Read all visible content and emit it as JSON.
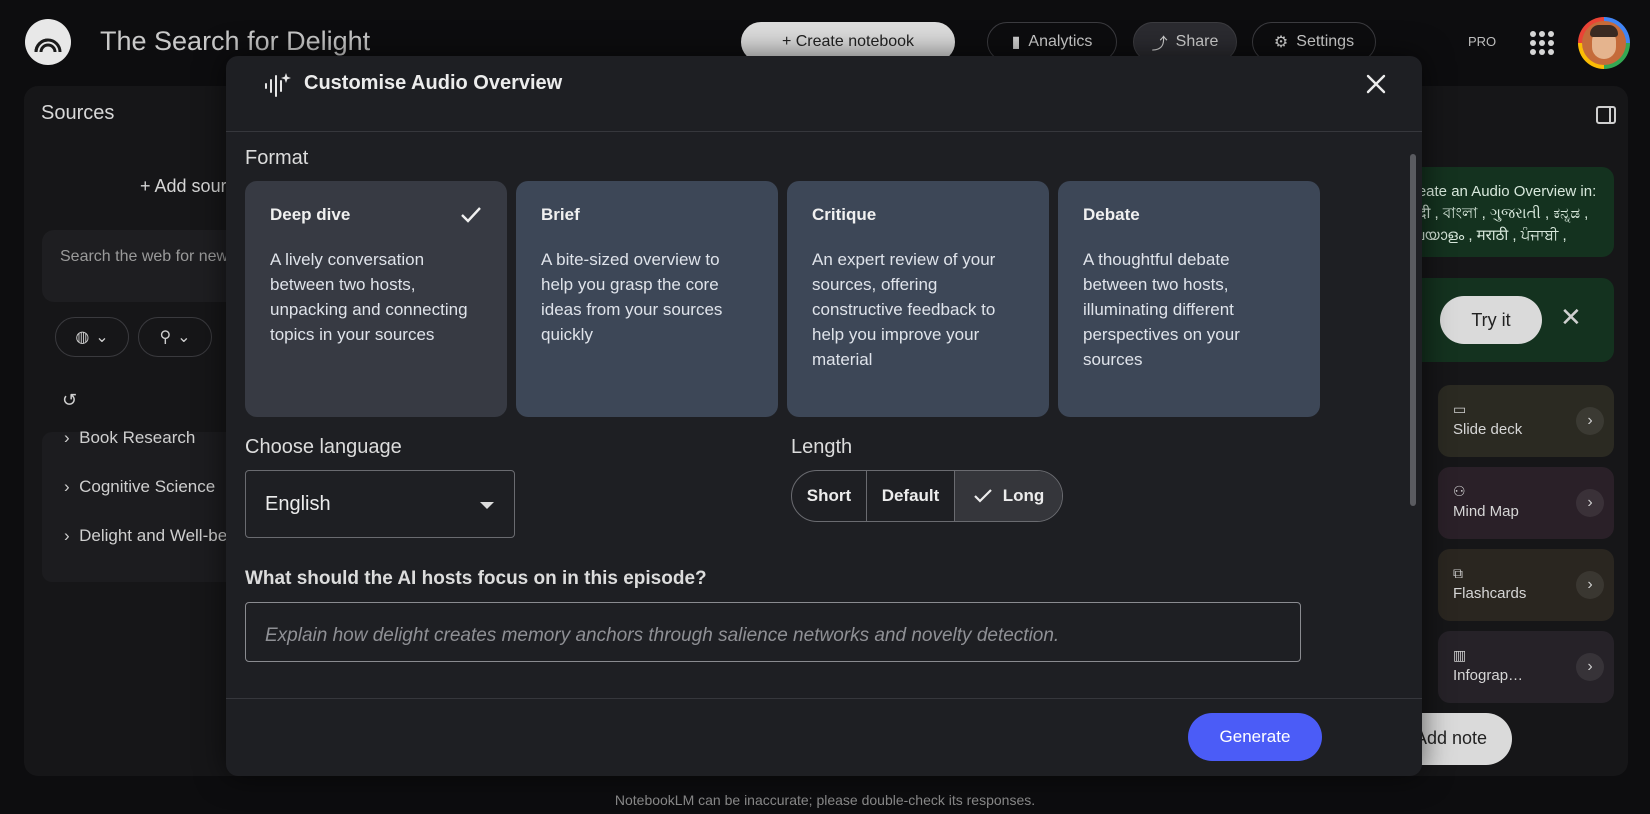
{
  "app": {
    "title": "The Search for Delight",
    "toolbar": {
      "create_notebook": "+ Create notebook",
      "analytics": "Analytics",
      "share": "Share",
      "settings": "Settings",
      "plan_badge": "PRO"
    },
    "footer_note": "NotebookLM can be inaccurate; please double-check its responses."
  },
  "sources_panel": {
    "title": "Sources",
    "add_source": "Add sources",
    "search_placeholder": "Search the web for new sources",
    "folders": [
      "Book Research",
      "Cognitive Science",
      "Delight and Well-being"
    ]
  },
  "studio_panel": {
    "language_banner": "Create an Audio Overview in: हिन्दी , বাংলা , ગુજરાતી , ಕನ್ನಡ , മലയാളം , मराठी , ਪੰਜਾਬੀ ,",
    "try_it": "Try it",
    "tiles": [
      {
        "label": "Slide deck",
        "icon": "slides-icon",
        "color": "#2b2a22"
      },
      {
        "label": "Mind Map",
        "icon": "mindmap-icon",
        "color": "#2a2028"
      },
      {
        "label": "Flashcards",
        "icon": "flashcards-icon",
        "color": "#2a2620"
      },
      {
        "label": "Infograp…",
        "icon": "infographic-icon",
        "color": "#262228"
      }
    ],
    "add_note": "Add note"
  },
  "modal": {
    "title": "Customise Audio Overview",
    "format_label": "Format",
    "formats": [
      {
        "title": "Deep dive",
        "description": "A lively conversation between two hosts, unpacking and connecting topics in your sources",
        "selected": true
      },
      {
        "title": "Brief",
        "description": "A bite-sized overview to help you grasp the core ideas from your sources quickly",
        "selected": false
      },
      {
        "title": "Critique",
        "description": "An expert review of your sources, offering constructive feedback to help you improve your material",
        "selected": false
      },
      {
        "title": "Debate",
        "description": "A thoughtful debate between two hosts, illuminating different perspectives on your sources",
        "selected": false
      }
    ],
    "language_label": "Choose language",
    "language_value": "English",
    "length_label": "Length",
    "length_options": [
      "Short",
      "Default",
      "Long"
    ],
    "length_selected": "Long",
    "focus_label": "What should the AI hosts focus on in this episode?",
    "focus_placeholder": "Explain how delight creates memory anchors through salience networks and novelty detection.",
    "generate_label": "Generate"
  },
  "colors": {
    "accent": "#4b5cf7",
    "card": "#3d4757",
    "card_selected": "#373a43",
    "modal_bg": "#1e1f23"
  }
}
